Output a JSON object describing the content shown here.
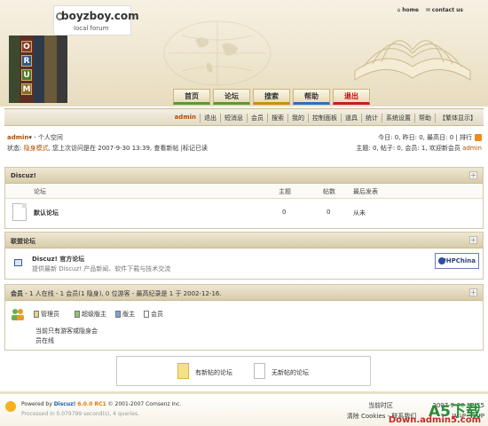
{
  "header": {
    "logo_title": "boyzboy.com",
    "logo_subtitle": "local forum",
    "forum_letters": [
      "O",
      "R",
      "U",
      "M"
    ],
    "top_links": {
      "home": "home",
      "contact": "contact us"
    },
    "nav_tabs": [
      "首页",
      "论坛",
      "搜索",
      "帮助",
      "退出"
    ]
  },
  "menubar": {
    "items": [
      "admin",
      "退出",
      "短消息",
      "会员",
      "搜索",
      "我的",
      "控制面板",
      "道具",
      "统计",
      "系统设置",
      "帮助",
      "【繁体显示】"
    ]
  },
  "userinfo": {
    "username": "admin",
    "arrow": "▾",
    "space": "- 个人空间",
    "status_label": "状态:",
    "invisible_mode": "隐身模式",
    "last_visit": ", 您上次访问是在 2007-9-30 13:39,",
    "view_new": "查看新帖",
    "mark_read": "|标记已读",
    "stats_right1": "今日: 0, 昨日: 0, 最高日: 0 |",
    "rank_link": "排行",
    "stats_right2": "主题: 0, 帖子: 0, 会员: 1, 欢迎新会员",
    "new_member": "admin"
  },
  "forum_section": {
    "title": "Discuz!",
    "columns": {
      "forum": "论坛",
      "topics": "主题",
      "posts": "帖数",
      "last_post": "最后发表"
    },
    "row": {
      "name": "默认论坛",
      "topics": "0",
      "posts": "0",
      "last_post": "从未"
    }
  },
  "union_section": {
    "title": "联盟论坛",
    "name": "Discuz! 官方论坛",
    "desc": "提供最新 Discuz! 产品新闻、软件下载与技术交流",
    "partner": "PHPChina"
  },
  "online_section": {
    "label": "会员",
    "stats": " - 1 人在线 - 1 会员(1 隐身), 0 位游客 - 最高纪录是 1 于 2002-12-16.",
    "legend": [
      "管理员",
      "超级版主",
      "版主",
      "会员"
    ],
    "empty_line1": "当前只有游客或隐身会",
    "empty_line2": "员在线"
  },
  "legend_box": {
    "new": "有新帖的论坛",
    "none": "无新帖的论坛"
  },
  "footer": {
    "powered_prefix": "Powered by",
    "brand": "Discuz!",
    "version": "6.0.0 RC1",
    "copyright": "© 2001-2007 Comsenz Inc.",
    "processed": "Processed in 0.079799 second(s), 4 queries.",
    "time_label": "当前时区",
    "time_value": "2007-9-30 13:55",
    "clear": "清除",
    "cookies": "Cookies",
    "contact": "- 联系我们",
    "wap_top": "WAP - TOP"
  },
  "watermark": {
    "main": "A5下载",
    "sub": "Down.admin5.com"
  },
  "colors": {
    "accent_brown": "#b05000",
    "nav_green": "#5a9a2a",
    "nav_red": "#c02020"
  }
}
